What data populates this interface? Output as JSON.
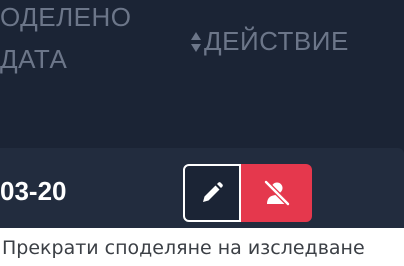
{
  "table": {
    "header": {
      "shared_date_line1": "оделено",
      "shared_date_line2": "дата",
      "action_label": "ДЕЙСТВИЕ"
    },
    "row": {
      "date_fragment": "03-20"
    },
    "actions": {
      "edit_icon": "pencil-icon",
      "unshare_icon": "user-slash-icon"
    }
  },
  "tooltip": {
    "text": "Прекрати споделяне на изследване"
  },
  "colors": {
    "panel_bg": "#1b2435",
    "row_bg": "#222c3e",
    "header_text": "#6c7689",
    "danger": "#e5384d",
    "white": "#ffffff"
  }
}
